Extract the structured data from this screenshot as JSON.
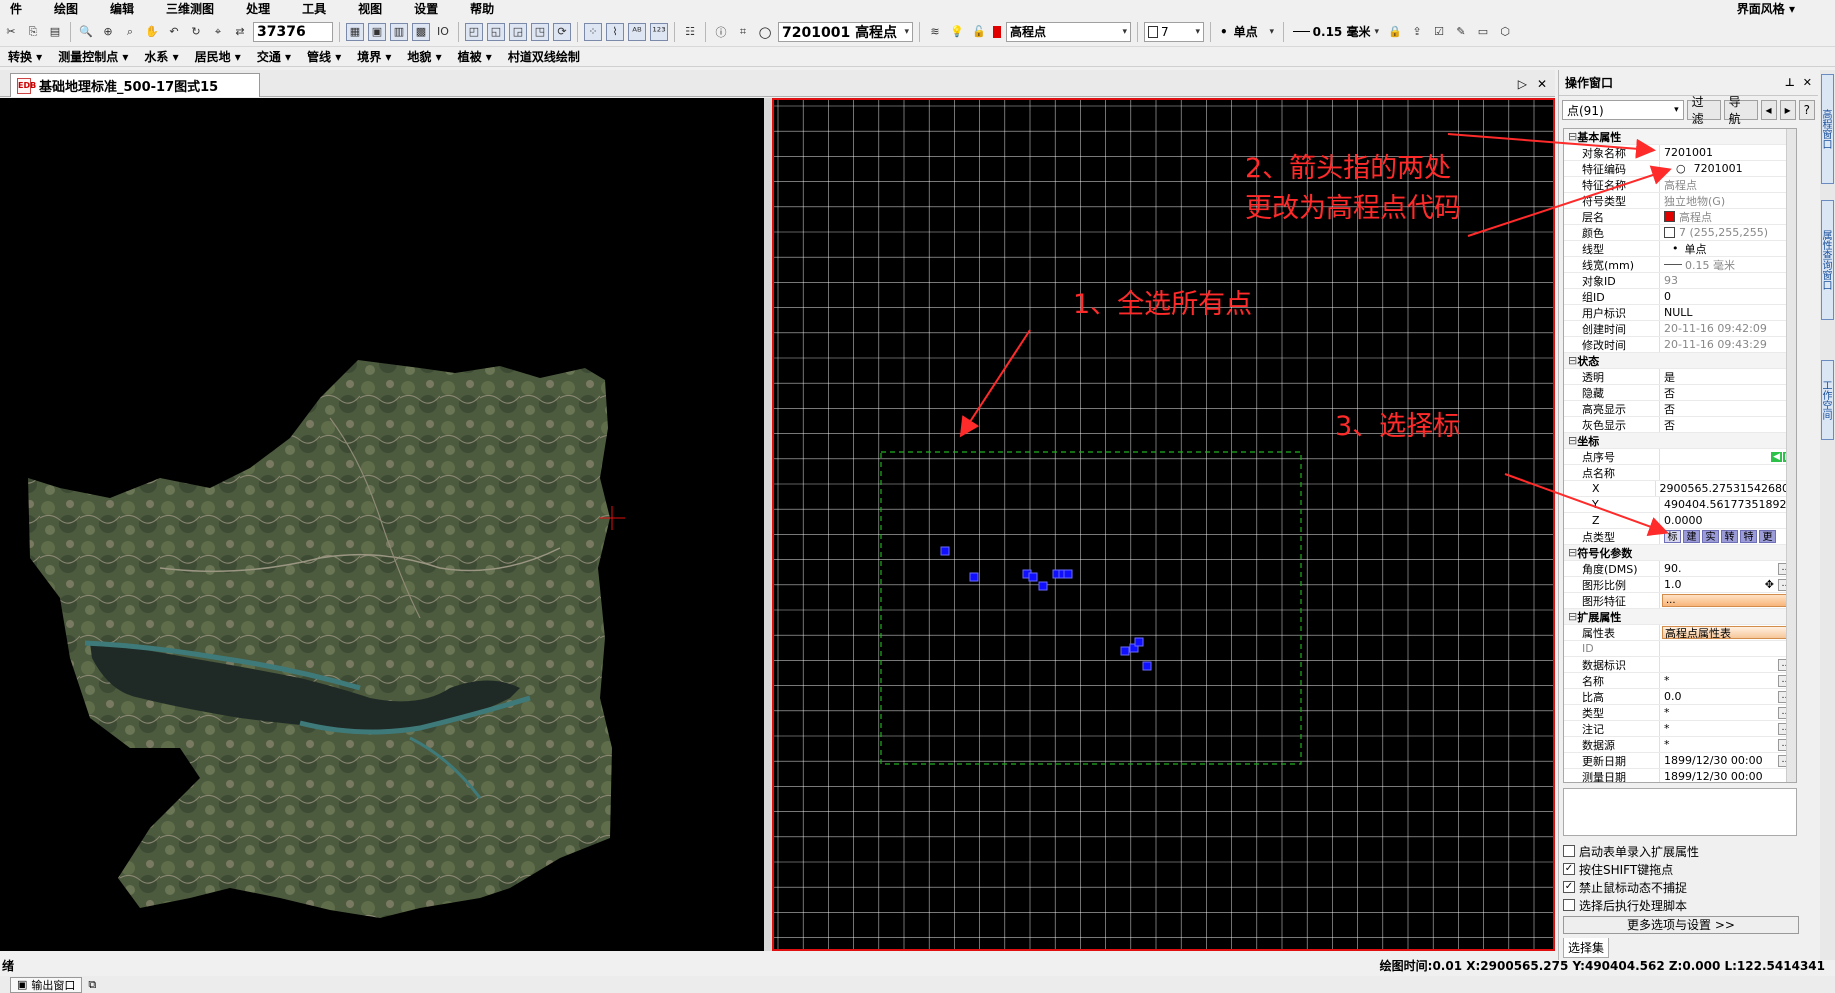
{
  "menubar": {
    "items": [
      "件",
      "绘图",
      "编辑",
      "三维测图",
      "处理",
      "工具",
      "视图",
      "设置",
      "帮助"
    ],
    "right": "界面风格 ▾"
  },
  "toolbar1": {
    "scale_value": "37376",
    "code_combo": "7201001 高程点",
    "layer_combo": "高程点",
    "color_value": "7",
    "line_type": "单点",
    "line_width": "0.15 毫米"
  },
  "toolbar2": {
    "items": [
      "转换 ▾",
      "测量控制点 ▾",
      "水系 ▾",
      "居民地 ▾",
      "交通 ▾",
      "管线 ▾",
      "境界 ▾",
      "地貌 ▾",
      "植被 ▾",
      "村道双线绘制"
    ]
  },
  "doc_tab": {
    "title": "基础地理标准_500-17图式15",
    "icon_text": "EDB"
  },
  "panel": {
    "title": "操作窗口",
    "selector": "点(91)",
    "filter_button": "过滤",
    "nav_button": "导航",
    "groups": {
      "basic": "基本属性",
      "status": "状态",
      "coords": "坐标",
      "symbol": "符号化参数",
      "ext": "扩展属性"
    },
    "rows": {
      "obj_name_k": "对象名称",
      "obj_name_v": "7201001",
      "feat_code_k": "特征编码",
      "feat_code_v": "7201001",
      "feat_name_k": "特征名称",
      "feat_name_v": "高程点",
      "sym_type_k": "符号类型",
      "sym_type_v": "独立地物(G)",
      "layer_k": "层名",
      "layer_v": "高程点",
      "color_k": "颜色",
      "color_v": "7 (255,255,255)",
      "ltype_k": "线型",
      "ltype_v": "单点",
      "lwidth_k": "线宽(mm)",
      "lwidth_v": "0.15 毫米",
      "objid_k": "对象ID",
      "objid_v": "93",
      "grpid_k": "组ID",
      "grpid_v": "0",
      "user_k": "用户标识",
      "user_v": "NULL",
      "ctime_k": "创建时间",
      "ctime_v": "20-11-16 09:42:09",
      "mtime_k": "修改时间",
      "mtime_v": "20-11-16 09:43:29",
      "transp_k": "透明",
      "transp_v": "是",
      "hidden_k": "隐藏",
      "hidden_v": "否",
      "hilite_k": "高亮显示",
      "hilite_v": "否",
      "grey_k": "灰色显示",
      "grey_v": "否",
      "ptseq_k": "点序号",
      "ptname_k": "点名称",
      "x_k": "X",
      "x_v": "2900565.275315426800",
      "y_k": "Y",
      "y_v": "490404.561773518920",
      "z_k": "Z",
      "z_v": "0.0000",
      "ptype_k": "点类型",
      "angle_k": "角度(DMS)",
      "angle_v": "90.",
      "gscale_k": "图形比例",
      "gscale_v": "1.0",
      "gfeat_k": "图形特征",
      "gfeat_v": "...",
      "attrtbl_k": "属性表",
      "attrtbl_v": "高程点属性表",
      "id_k": "ID",
      "dataid_k": "数据标识",
      "name_k": "名称",
      "name_v": "*",
      "relh_k": "比高",
      "relh_v": "0.0",
      "type_k": "类型",
      "type_v": "*",
      "note_k": "注记",
      "note_v": "*",
      "src_k": "数据源",
      "src_v": "*",
      "udate_k": "更新日期",
      "udate_v": "1899/12/30 00:00",
      "sdate_k": "测量日期",
      "sdate_v": "1899/12/30 00:00"
    },
    "point_types": [
      "标",
      "建",
      "实",
      "转",
      "特",
      "更"
    ],
    "checks": [
      {
        "label": "启动表单录入扩展属性",
        "checked": false
      },
      {
        "label": "按住SHIFT键拖点",
        "checked": true
      },
      {
        "label": "禁止鼠标动态不捕捉",
        "checked": true
      },
      {
        "label": "选择后执行处理脚本",
        "checked": false
      }
    ],
    "more_options": "更多选项与设置 >>",
    "bottom_tab": "选择集"
  },
  "side_tabs": [
    "高程窗口",
    "属性查询窗口",
    "工作空间"
  ],
  "status_bar": {
    "left": "绪",
    "readout": "绘图时间:0.01 X:2900565.275 Y:490404.562 Z:0.000 L:122.5414341"
  },
  "bottom_tab": "输出窗口",
  "annotations": {
    "a1": "1、全选所有点",
    "a2_line1": "2、箭头指的两处",
    "a2_line2": "更改为高程点代码",
    "a3": "3、选择标"
  },
  "colors": {
    "annotation": "#ff2a2a",
    "view_border": "#e01010",
    "grid": "#ffffff",
    "points": "#1010ff",
    "extent": "#20b020"
  }
}
